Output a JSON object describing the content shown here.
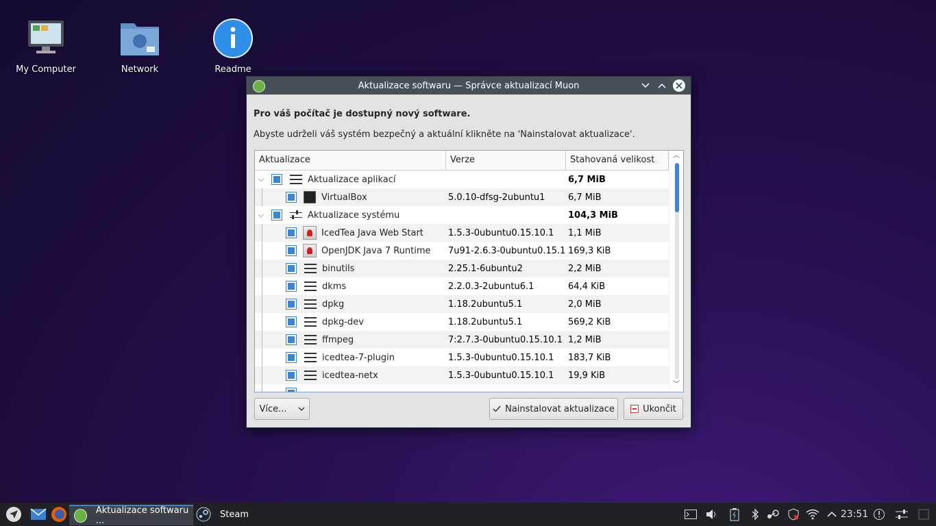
{
  "desktop": {
    "icons": [
      {
        "label": "My Computer",
        "icon": "computer-icon"
      },
      {
        "label": "Network",
        "icon": "network-folder-icon"
      },
      {
        "label": "Readme",
        "icon": "info-icon"
      }
    ]
  },
  "window": {
    "title": "Aktualizace softwaru — Správce aktualizací Muon",
    "headline": "Pro váš počítač je dostupný nový software.",
    "subline": "Abyste udrželi váš systém bezpečný a aktuální klikněte na 'Nainstalovat aktualizace'.",
    "columns": [
      "Aktualizace",
      "Verze",
      "Stahovaná velikost"
    ],
    "groups": [
      {
        "name": "Aktualizace aplikací",
        "size": "6,7 MiB",
        "items": [
          {
            "name": "VirtualBox",
            "version": "5.0.10-dfsg-2ubuntu1",
            "size": "6,7 MiB"
          }
        ]
      },
      {
        "name": "Aktualizace systému",
        "size": "104,3 MiB",
        "items": [
          {
            "name": "IcedTea Java Web Start",
            "version": "1.5.3-0ubuntu0.15.10.1",
            "size": "1,1 MiB"
          },
          {
            "name": "OpenJDK Java 7 Runtime",
            "version": "7u91-2.6.3-0ubuntu0.15.1...",
            "size": "169,3 KiB"
          },
          {
            "name": "binutils",
            "version": "2.25.1-6ubuntu2",
            "size": "2,2 MiB"
          },
          {
            "name": "dkms",
            "version": "2.2.0.3-2ubuntu6.1",
            "size": "64,4 KiB"
          },
          {
            "name": "dpkg",
            "version": "1.18.2ubuntu5.1",
            "size": "2,0 MiB"
          },
          {
            "name": "dpkg-dev",
            "version": "1.18.2ubuntu5.1",
            "size": "569,2 KiB"
          },
          {
            "name": "ffmpeg",
            "version": "7:2.7.3-0ubuntu0.15.10.1",
            "size": "1,2 MiB"
          },
          {
            "name": "icedtea-7-plugin",
            "version": "1.5.3-0ubuntu0.15.10.1",
            "size": "183,7 KiB"
          },
          {
            "name": "icedtea-netx",
            "version": "1.5.3-0ubuntu0.15.10.1",
            "size": "19,9 KiB"
          }
        ]
      }
    ],
    "buttons": {
      "more": "Více...",
      "install": "Nainstalovat aktualizace",
      "quit": "Ukončit"
    }
  },
  "taskbar": {
    "tasks": [
      {
        "label": "Aktualizace softwaru ..."
      },
      {
        "label": "Steam"
      }
    ],
    "clock": "23:51"
  },
  "colors": {
    "accent": "#3a86d4",
    "titlebar": "#475057",
    "taskbar": "#1f2124"
  }
}
